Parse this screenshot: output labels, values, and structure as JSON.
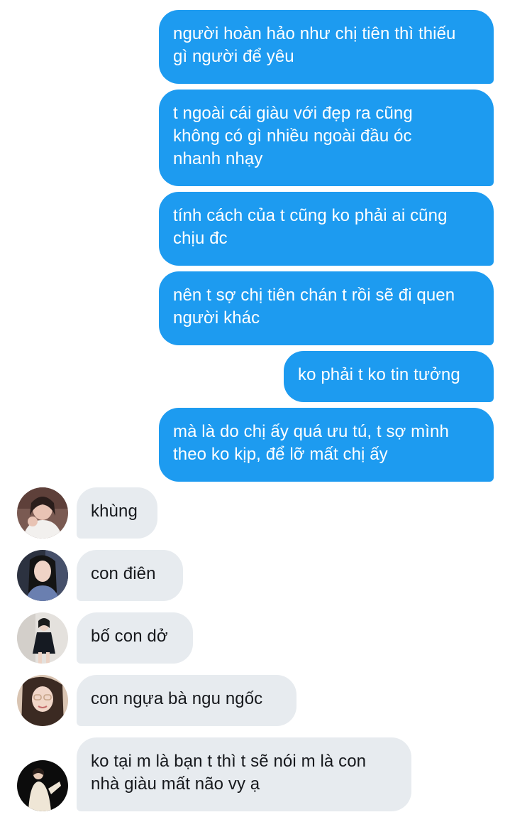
{
  "sent_messages": [
    {
      "text": "người hoàn hảo như chị tiên thì thiếu\ngì người để yêu"
    },
    {
      "text": "t ngoài cái giàu với đẹp ra cũng\nkhông có gì nhiều ngoài đầu óc\nnhanh nhạy"
    },
    {
      "text": "tính cách của t cũng ko phải ai cũng\nchịu đc"
    },
    {
      "text": "nên t sợ chị tiên chán t rồi sẽ đi quen\nngười khác"
    },
    {
      "text": "ko phải t ko tin tưởng"
    },
    {
      "text": "mà là do chị ấy quá ưu tú, t sợ mình\ntheo ko kịp, để lỡ mất chị ấy"
    }
  ],
  "received_messages": [
    {
      "text": "khùng",
      "avatar": "avatar-girl-white-outfit"
    },
    {
      "text": "con điên",
      "avatar": "avatar-girl-dark-hair"
    },
    {
      "text": "bố con dở",
      "avatar": "avatar-girl-black-dress"
    },
    {
      "text": "con ngựa bà ngu ngốc",
      "avatar": "avatar-girl-glasses"
    },
    {
      "text": "ko tại m là bạn t thì t sẽ nói m là con\nnhà giàu mất não vy ạ",
      "avatar": "avatar-girl-dark-background"
    }
  ],
  "colors": {
    "sent_bubble": "#1d9bf0",
    "received_bubble": "#e7ebef",
    "background": "#ffffff"
  }
}
